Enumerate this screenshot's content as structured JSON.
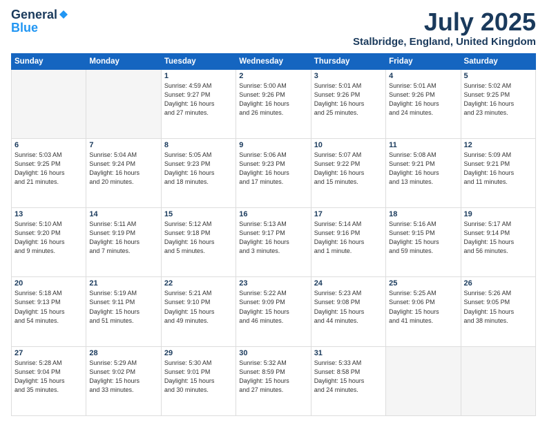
{
  "header": {
    "logo_general": "General",
    "logo_blue": "Blue",
    "month_title": "July 2025",
    "location": "Stalbridge, England, United Kingdom"
  },
  "weekdays": [
    "Sunday",
    "Monday",
    "Tuesday",
    "Wednesday",
    "Thursday",
    "Friday",
    "Saturday"
  ],
  "weeks": [
    [
      {
        "day": "",
        "info": ""
      },
      {
        "day": "",
        "info": ""
      },
      {
        "day": "1",
        "info": "Sunrise: 4:59 AM\nSunset: 9:27 PM\nDaylight: 16 hours\nand 27 minutes."
      },
      {
        "day": "2",
        "info": "Sunrise: 5:00 AM\nSunset: 9:26 PM\nDaylight: 16 hours\nand 26 minutes."
      },
      {
        "day": "3",
        "info": "Sunrise: 5:01 AM\nSunset: 9:26 PM\nDaylight: 16 hours\nand 25 minutes."
      },
      {
        "day": "4",
        "info": "Sunrise: 5:01 AM\nSunset: 9:26 PM\nDaylight: 16 hours\nand 24 minutes."
      },
      {
        "day": "5",
        "info": "Sunrise: 5:02 AM\nSunset: 9:25 PM\nDaylight: 16 hours\nand 23 minutes."
      }
    ],
    [
      {
        "day": "6",
        "info": "Sunrise: 5:03 AM\nSunset: 9:25 PM\nDaylight: 16 hours\nand 21 minutes."
      },
      {
        "day": "7",
        "info": "Sunrise: 5:04 AM\nSunset: 9:24 PM\nDaylight: 16 hours\nand 20 minutes."
      },
      {
        "day": "8",
        "info": "Sunrise: 5:05 AM\nSunset: 9:23 PM\nDaylight: 16 hours\nand 18 minutes."
      },
      {
        "day": "9",
        "info": "Sunrise: 5:06 AM\nSunset: 9:23 PM\nDaylight: 16 hours\nand 17 minutes."
      },
      {
        "day": "10",
        "info": "Sunrise: 5:07 AM\nSunset: 9:22 PM\nDaylight: 16 hours\nand 15 minutes."
      },
      {
        "day": "11",
        "info": "Sunrise: 5:08 AM\nSunset: 9:21 PM\nDaylight: 16 hours\nand 13 minutes."
      },
      {
        "day": "12",
        "info": "Sunrise: 5:09 AM\nSunset: 9:21 PM\nDaylight: 16 hours\nand 11 minutes."
      }
    ],
    [
      {
        "day": "13",
        "info": "Sunrise: 5:10 AM\nSunset: 9:20 PM\nDaylight: 16 hours\nand 9 minutes."
      },
      {
        "day": "14",
        "info": "Sunrise: 5:11 AM\nSunset: 9:19 PM\nDaylight: 16 hours\nand 7 minutes."
      },
      {
        "day": "15",
        "info": "Sunrise: 5:12 AM\nSunset: 9:18 PM\nDaylight: 16 hours\nand 5 minutes."
      },
      {
        "day": "16",
        "info": "Sunrise: 5:13 AM\nSunset: 9:17 PM\nDaylight: 16 hours\nand 3 minutes."
      },
      {
        "day": "17",
        "info": "Sunrise: 5:14 AM\nSunset: 9:16 PM\nDaylight: 16 hours\nand 1 minute."
      },
      {
        "day": "18",
        "info": "Sunrise: 5:16 AM\nSunset: 9:15 PM\nDaylight: 15 hours\nand 59 minutes."
      },
      {
        "day": "19",
        "info": "Sunrise: 5:17 AM\nSunset: 9:14 PM\nDaylight: 15 hours\nand 56 minutes."
      }
    ],
    [
      {
        "day": "20",
        "info": "Sunrise: 5:18 AM\nSunset: 9:13 PM\nDaylight: 15 hours\nand 54 minutes."
      },
      {
        "day": "21",
        "info": "Sunrise: 5:19 AM\nSunset: 9:11 PM\nDaylight: 15 hours\nand 51 minutes."
      },
      {
        "day": "22",
        "info": "Sunrise: 5:21 AM\nSunset: 9:10 PM\nDaylight: 15 hours\nand 49 minutes."
      },
      {
        "day": "23",
        "info": "Sunrise: 5:22 AM\nSunset: 9:09 PM\nDaylight: 15 hours\nand 46 minutes."
      },
      {
        "day": "24",
        "info": "Sunrise: 5:23 AM\nSunset: 9:08 PM\nDaylight: 15 hours\nand 44 minutes."
      },
      {
        "day": "25",
        "info": "Sunrise: 5:25 AM\nSunset: 9:06 PM\nDaylight: 15 hours\nand 41 minutes."
      },
      {
        "day": "26",
        "info": "Sunrise: 5:26 AM\nSunset: 9:05 PM\nDaylight: 15 hours\nand 38 minutes."
      }
    ],
    [
      {
        "day": "27",
        "info": "Sunrise: 5:28 AM\nSunset: 9:04 PM\nDaylight: 15 hours\nand 35 minutes."
      },
      {
        "day": "28",
        "info": "Sunrise: 5:29 AM\nSunset: 9:02 PM\nDaylight: 15 hours\nand 33 minutes."
      },
      {
        "day": "29",
        "info": "Sunrise: 5:30 AM\nSunset: 9:01 PM\nDaylight: 15 hours\nand 30 minutes."
      },
      {
        "day": "30",
        "info": "Sunrise: 5:32 AM\nSunset: 8:59 PM\nDaylight: 15 hours\nand 27 minutes."
      },
      {
        "day": "31",
        "info": "Sunrise: 5:33 AM\nSunset: 8:58 PM\nDaylight: 15 hours\nand 24 minutes."
      },
      {
        "day": "",
        "info": ""
      },
      {
        "day": "",
        "info": ""
      }
    ]
  ]
}
